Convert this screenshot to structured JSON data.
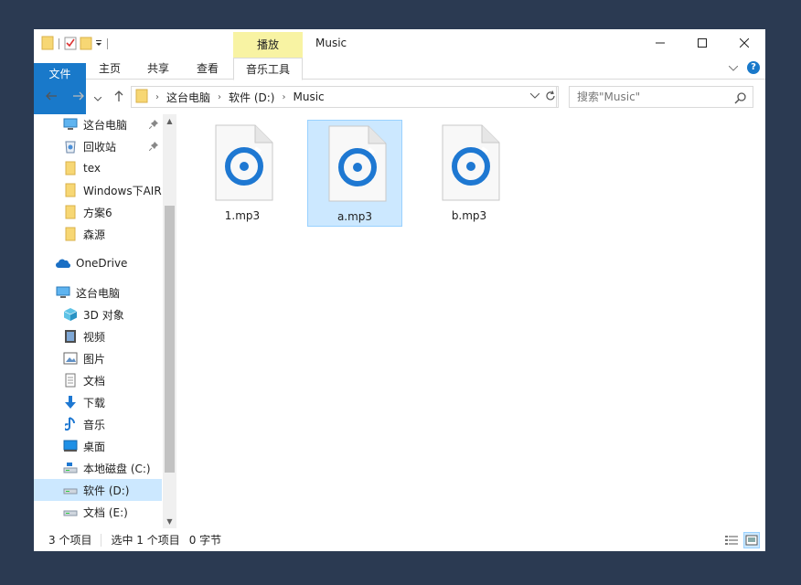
{
  "window": {
    "title": "Music"
  },
  "ribbon": {
    "context_tab_title": "播放",
    "tabs": [
      "文件",
      "主页",
      "共享",
      "查看",
      "音乐工具"
    ]
  },
  "address": {
    "crumbs": [
      "这台电脑",
      "软件 (D:)",
      "Music"
    ]
  },
  "search": {
    "placeholder": "搜索\"Music\""
  },
  "nav": {
    "quick_access": [
      {
        "label": "这台电脑",
        "icon": "computer-icon",
        "pinned": true
      },
      {
        "label": "回收站",
        "icon": "recycle-bin-icon",
        "pinned": true
      },
      {
        "label": "tex",
        "icon": "folder-icon"
      },
      {
        "label": "Windows下AIR",
        "icon": "folder-icon"
      },
      {
        "label": "方案6",
        "icon": "folder-icon"
      },
      {
        "label": "森源",
        "icon": "folder-icon"
      }
    ],
    "onedrive": "OneDrive",
    "this_pc": "这台电脑",
    "pc_items": [
      {
        "label": "3D 对象",
        "icon": "3d-objects-icon"
      },
      {
        "label": "视频",
        "icon": "videos-icon"
      },
      {
        "label": "图片",
        "icon": "pictures-icon"
      },
      {
        "label": "文档",
        "icon": "documents-icon"
      },
      {
        "label": "下载",
        "icon": "downloads-icon"
      },
      {
        "label": "音乐",
        "icon": "music-icon"
      },
      {
        "label": "桌面",
        "icon": "desktop-icon"
      },
      {
        "label": "本地磁盘 (C:)",
        "icon": "drive-c-icon"
      },
      {
        "label": "软件 (D:)",
        "icon": "drive-d-icon",
        "selected": true
      },
      {
        "label": "文档 (E:)",
        "icon": "drive-e-icon"
      }
    ]
  },
  "files": [
    {
      "name": "1.mp3",
      "selected": false
    },
    {
      "name": "a.mp3",
      "selected": true
    },
    {
      "name": "b.mp3",
      "selected": false
    }
  ],
  "status": {
    "count": "3 个项目",
    "selection": "选中 1 个项目",
    "size": "0 字节"
  },
  "colors": {
    "accent": "#1979ca",
    "selection": "#cce8ff",
    "context_tab": "#f8f3a3",
    "background": "#2b3a52"
  }
}
